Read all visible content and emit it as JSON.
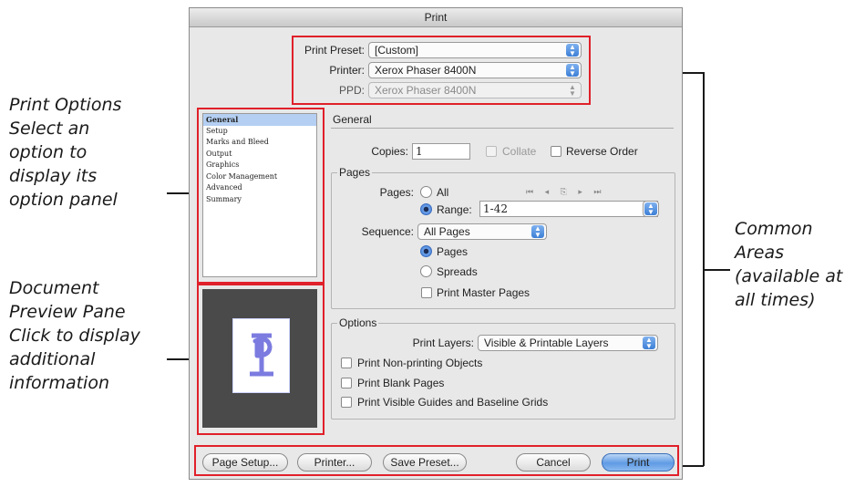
{
  "annotations": {
    "print_options": [
      "Print Options",
      "Select an",
      "option to",
      "display its",
      "option panel"
    ],
    "preview_pane": [
      "Document",
      "Preview Pane",
      "Click to display",
      "additional",
      "information"
    ],
    "common_areas": [
      "Common",
      "Areas",
      "(available at",
      "all times)"
    ]
  },
  "dialog": {
    "title": "Print",
    "print_preset_label": "Print Preset:",
    "print_preset_value": "[Custom]",
    "printer_label": "Printer:",
    "printer_value": "Xerox Phaser 8400N",
    "ppd_label": "PPD:",
    "ppd_value": "Xerox Phaser 8400N"
  },
  "sidebar": {
    "items": [
      {
        "label": "General",
        "selected": true
      },
      {
        "label": "Setup"
      },
      {
        "label": "Marks and Bleed"
      },
      {
        "label": "Output"
      },
      {
        "label": "Graphics"
      },
      {
        "label": "Color Management"
      },
      {
        "label": "Advanced"
      },
      {
        "label": "Summary"
      }
    ]
  },
  "general": {
    "title": "General",
    "copies_label": "Copies:",
    "copies_value": "1",
    "collate_label": "Collate",
    "reverse_order_label": "Reverse Order",
    "pages_group_title": "Pages",
    "pages_label": "Pages:",
    "all_label": "All",
    "range_label": "Range:",
    "range_value": "1-42",
    "nav_icons": "⏮ ◂ ⎘ ▸ ⏭",
    "sequence_label": "Sequence:",
    "sequence_value": "All Pages",
    "pages_radio_label": "Pages",
    "spreads_radio_label": "Spreads",
    "print_master_pages_label": "Print Master Pages",
    "options_group_title": "Options",
    "print_layers_label": "Print Layers:",
    "print_layers_value": "Visible & Printable Layers",
    "non_printing_label": "Print Non-printing Objects",
    "blank_pages_label": "Print Blank Pages",
    "guides_label": "Print Visible Guides and Baseline Grids"
  },
  "buttons": {
    "page_setup": "Page Setup...",
    "printer": "Printer...",
    "save_preset": "Save Preset...",
    "cancel": "Cancel",
    "print": "Print"
  },
  "colors": {
    "highlight_red": "#e0202a",
    "selection_blue": "#b4cff2",
    "default_button_blue": "#5f9be4"
  }
}
